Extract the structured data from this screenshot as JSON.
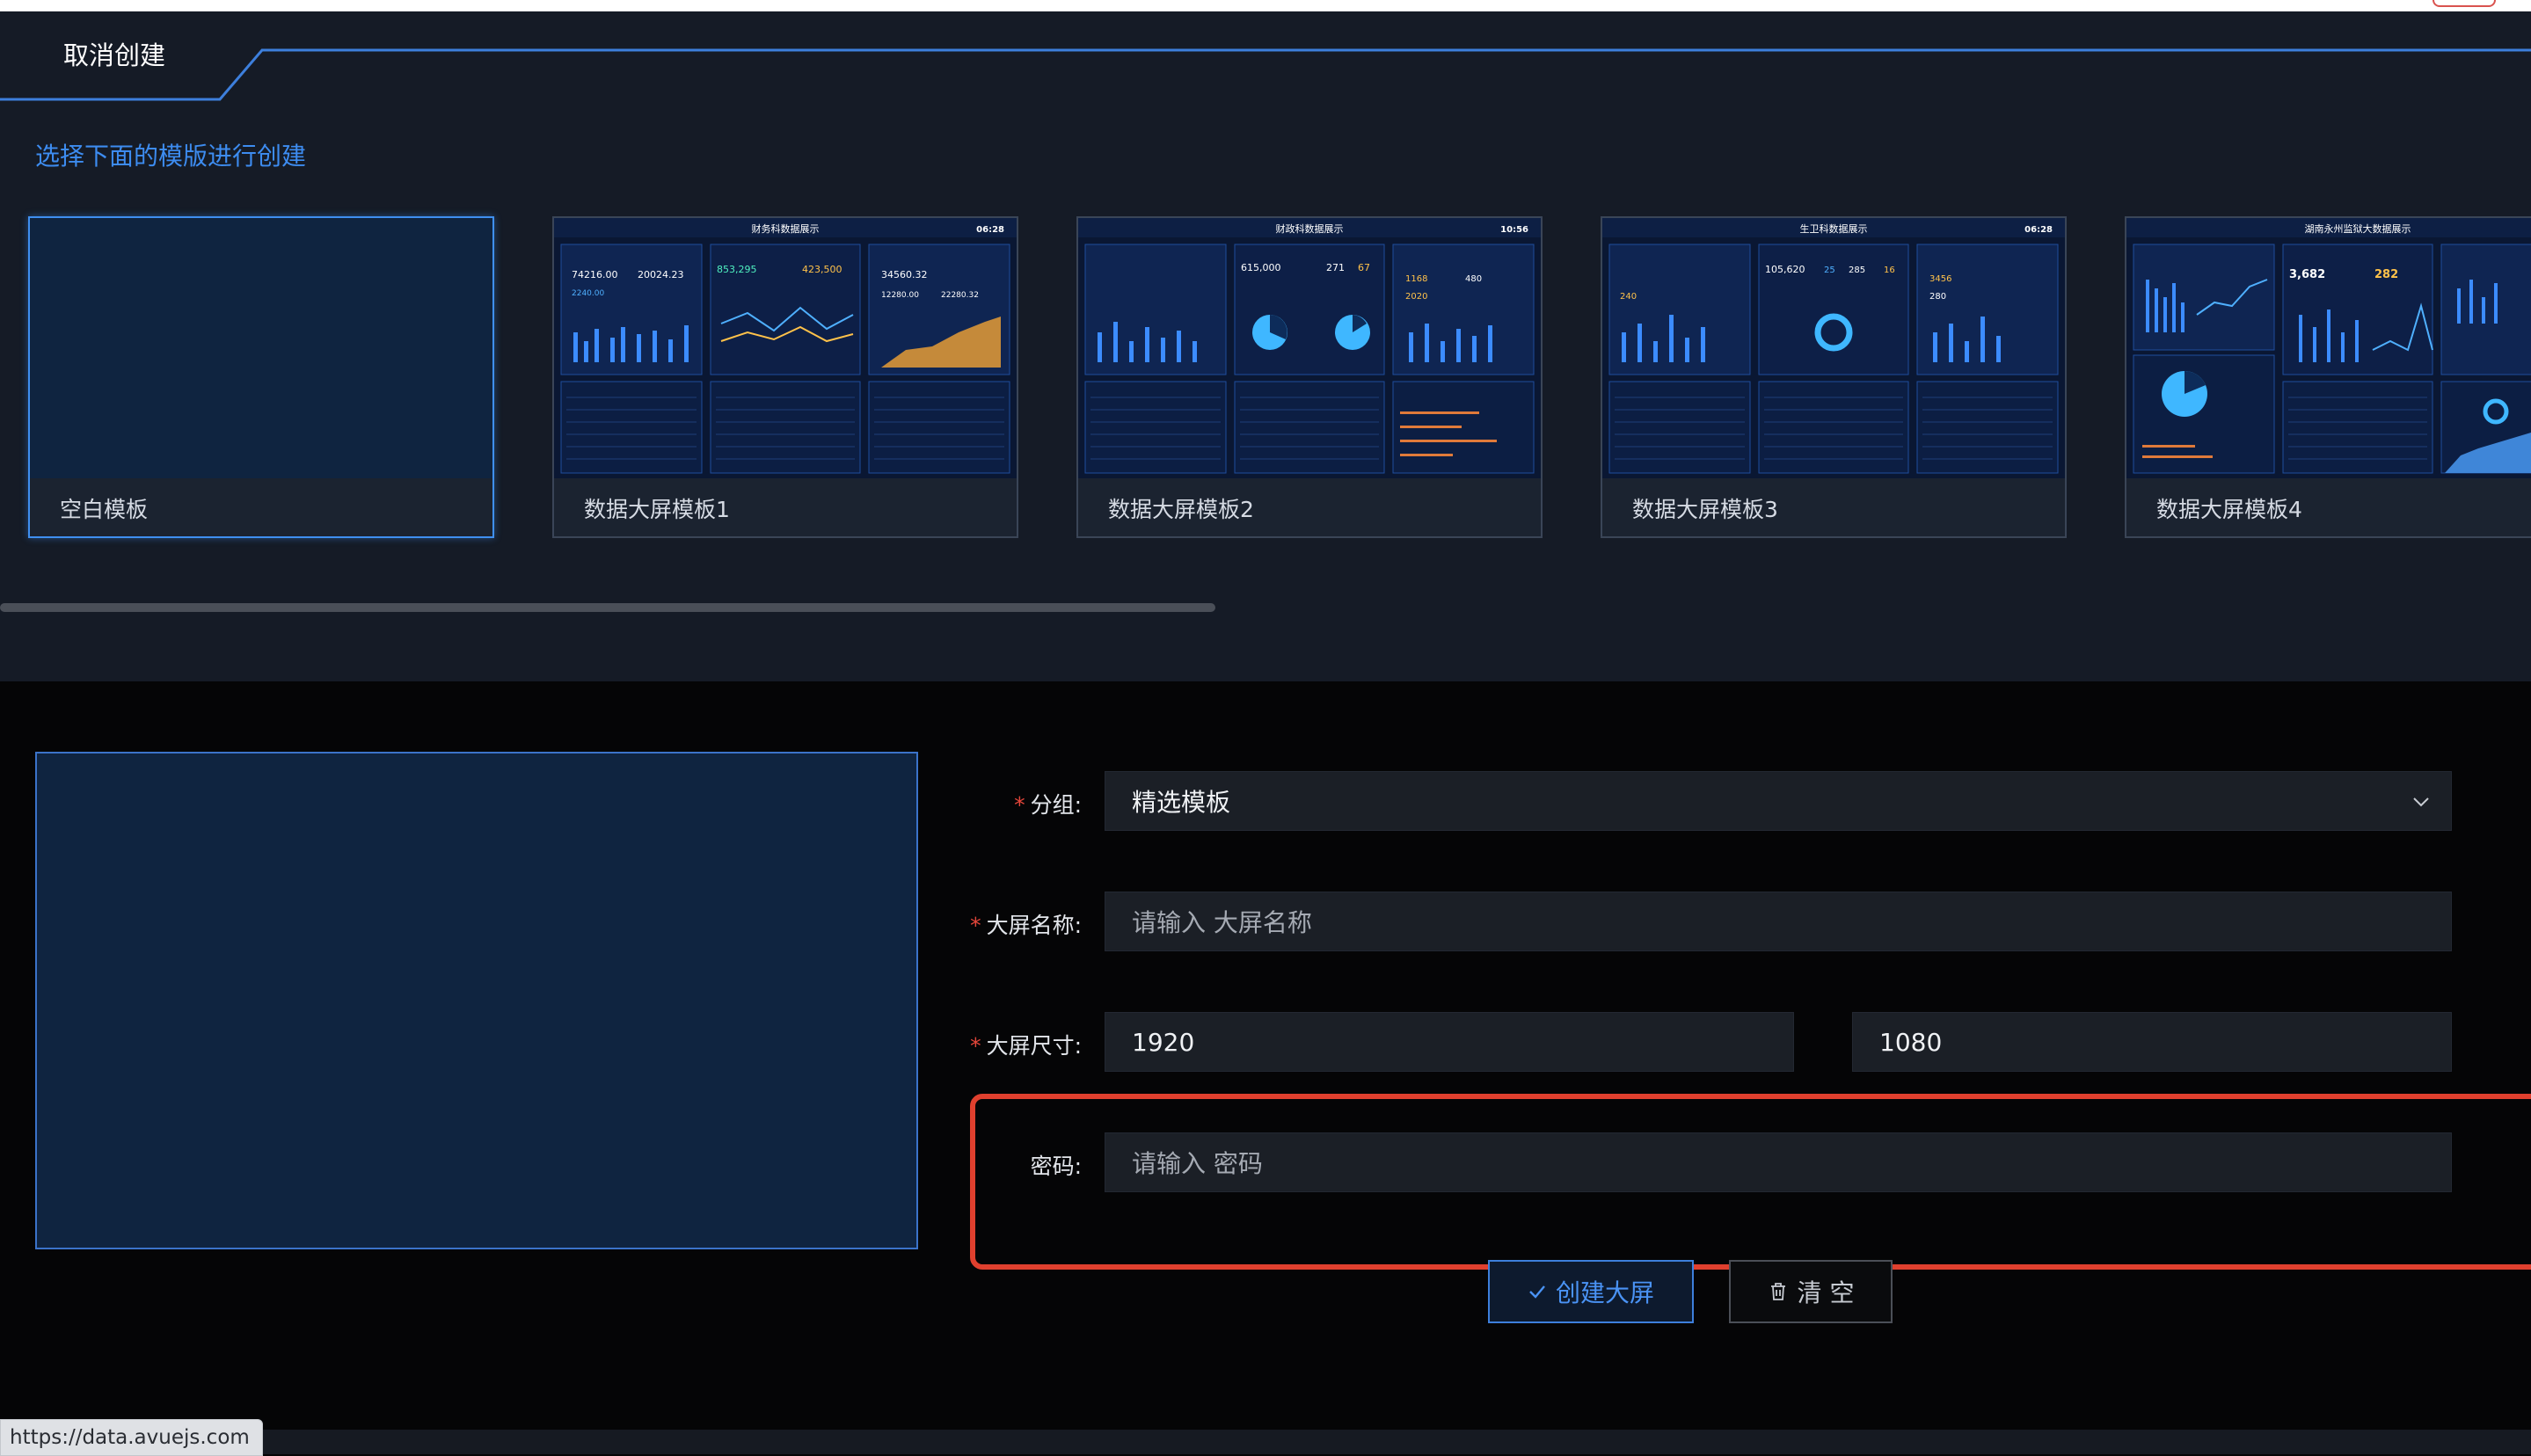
{
  "header": {
    "cancel_tab": "取消创建"
  },
  "templates": {
    "section_title": "选择下面的模版进行创建",
    "items": [
      {
        "label": "空白模板",
        "selected": true
      },
      {
        "label": "数据大屏模板1",
        "thumb_title": "财务科数据展示",
        "thumb_time": "06:28"
      },
      {
        "label": "数据大屏模板2",
        "thumb_title": "财政科数据展示",
        "thumb_time": "10:56"
      },
      {
        "label": "数据大屏模板3",
        "thumb_title": "生卫科数据展示",
        "thumb_time": "06:28"
      },
      {
        "label": "数据大屏模板4",
        "thumb_title": "湖南永州监狱大数据展示"
      }
    ],
    "thumb_numbers": {
      "t1": [
        "74216.00",
        "20024.23",
        "853,295",
        "423,500",
        "34560.32",
        "2240.00",
        "12280.00",
        "22280.32"
      ],
      "t2": [
        "615,000",
        "271",
        "67",
        "1168",
        "2020",
        "480"
      ],
      "t3": [
        "105,620",
        "25",
        "285",
        "16",
        "3456",
        "280",
        "240"
      ],
      "t4": [
        "3,682",
        "282"
      ]
    }
  },
  "form": {
    "group": {
      "label": "分组:",
      "value": "精选模板",
      "required": true
    },
    "name": {
      "label": "大屏名称:",
      "placeholder": "请输入 大屏名称",
      "required": true
    },
    "size": {
      "label": "大屏尺寸:",
      "width": "1920",
      "height": "1080",
      "required": true
    },
    "password": {
      "label": "密码:",
      "placeholder": "请输入 密码",
      "required": false
    },
    "required_mark": "*"
  },
  "buttons": {
    "create": "创建大屏",
    "clear": "清 空"
  },
  "status_bar": {
    "url": "https://data.avuejs.com"
  },
  "colors": {
    "accent": "#3d8cf0",
    "highlight": "#e0402e",
    "required": "#e5463a"
  }
}
